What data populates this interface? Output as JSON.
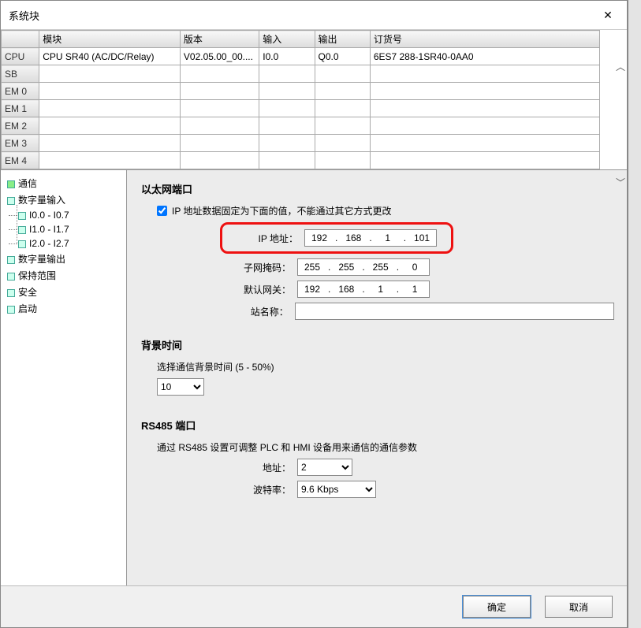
{
  "title": "系统块",
  "grid": {
    "headers": [
      "",
      "模块",
      "版本",
      "输入",
      "输出",
      "订货号"
    ],
    "rowlabels": [
      "CPU",
      "SB",
      "EM 0",
      "EM 1",
      "EM 2",
      "EM 3",
      "EM 4"
    ],
    "rows": [
      [
        "CPU SR40 (AC/DC/Relay)",
        "V02.05.00_00....",
        "I0.0",
        "Q0.0",
        "6ES7 288-1SR40-0AA0"
      ],
      [
        "",
        "",
        "",
        "",
        ""
      ],
      [
        "",
        "",
        "",
        "",
        ""
      ],
      [
        "",
        "",
        "",
        "",
        ""
      ],
      [
        "",
        "",
        "",
        "",
        ""
      ],
      [
        "",
        "",
        "",
        "",
        ""
      ],
      [
        "",
        "",
        "",
        "",
        ""
      ]
    ]
  },
  "tree": {
    "items": [
      {
        "label": "通信",
        "selected": true
      },
      {
        "label": "数字量输入",
        "children": [
          {
            "label": "I0.0 - I0.7"
          },
          {
            "label": "I1.0 - I1.7"
          },
          {
            "label": "I2.0 - I2.7"
          }
        ]
      },
      {
        "label": "数字量输出"
      },
      {
        "label": "保持范围"
      },
      {
        "label": "安全"
      },
      {
        "label": "启动"
      }
    ]
  },
  "eth": {
    "title": "以太网端口",
    "fixed_label": "IP 地址数据固定为下面的值，不能通过其它方式更改",
    "ip_label": "IP 地址：",
    "ip": [
      "192",
      "168",
      "1",
      "101"
    ],
    "mask_label": "子网掩码：",
    "mask": [
      "255",
      "255",
      "255",
      "0"
    ],
    "gw_label": "默认网关：",
    "gw": [
      "192",
      "168",
      "1",
      "1"
    ],
    "station_label": "站名称：",
    "station": ""
  },
  "bg": {
    "title": "背景时间",
    "desc": "选择通信背景时间 (5 - 50%)",
    "value": "10"
  },
  "rs485": {
    "title": "RS485 端口",
    "desc": "通过 RS485 设置可调整 PLC 和 HMI 设备用来通信的通信参数",
    "addr_label": "地址：",
    "addr": "2",
    "baud_label": "波特率：",
    "baud": "9.6 Kbps"
  },
  "buttons": {
    "ok": "确定",
    "cancel": "取消"
  }
}
